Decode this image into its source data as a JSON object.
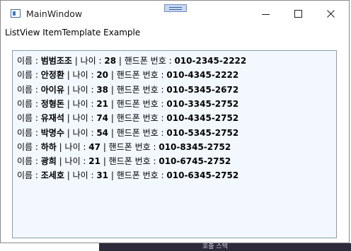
{
  "window": {
    "title": "MainWindow",
    "icon": "app-window-icon",
    "controls": {
      "minimize_icon": "minimize-icon",
      "maximize_icon": "maximize-icon",
      "close_icon": "close-icon"
    }
  },
  "header": {
    "label": "ListView ItemTemplate Example"
  },
  "list": {
    "items": [
      {
        "name_label": "이름 : ",
        "name": "범범조조",
        "age_label": " | 나이 : ",
        "age": "28",
        "phone_label": " | 핸드폰 번호 : ",
        "phone": "010-2345-2222"
      },
      {
        "name_label": "이름 : ",
        "name": "안정환",
        "age_label": " | 나이 : ",
        "age": "20",
        "phone_label": " | 핸드폰 번호 : ",
        "phone": "010-4345-2222"
      },
      {
        "name_label": "이름 : ",
        "name": "아이유",
        "age_label": " | 나이 : ",
        "age": "38",
        "phone_label": " | 핸드폰 번호 : ",
        "phone": "010-5345-2672"
      },
      {
        "name_label": "이름 : ",
        "name": "정형돈",
        "age_label": " | 나이 : ",
        "age": "21",
        "phone_label": " | 핸드폰 번호 : ",
        "phone": "010-3345-2752"
      },
      {
        "name_label": "이름 : ",
        "name": "유재석",
        "age_label": " | 나이 : ",
        "age": "74",
        "phone_label": " | 핸드폰 번호 : ",
        "phone": "010-4345-2752"
      },
      {
        "name_label": "이름 : ",
        "name": "박명수",
        "age_label": " | 나이 : ",
        "age": "54",
        "phone_label": " | 핸드폰 번호 : ",
        "phone": "010-5345-2752"
      },
      {
        "name_label": "이름 : ",
        "name": "하하",
        "age_label": " | 나이 : ",
        "age": "47",
        "phone_label": " | 핸드폰 번호 : ",
        "phone": "010-8345-2752"
      },
      {
        "name_label": "이름 : ",
        "name": "광희",
        "age_label": " | 나이 : ",
        "age": "21",
        "phone_label": " | 핸드폰 번호 : ",
        "phone": "010-6745-2752"
      },
      {
        "name_label": "이름 : ",
        "name": "조세호",
        "age_label": " | 나이 : ",
        "age": "31",
        "phone_label": " | 핸드폰 번호 : ",
        "phone": "010-6345-2752"
      }
    ]
  },
  "background": {
    "taskbar_text": "호출 스택"
  },
  "colors": {
    "list_background": "#f2f8fe",
    "list_border": "#8a9bb0",
    "window_border": "#8a8a8a"
  }
}
